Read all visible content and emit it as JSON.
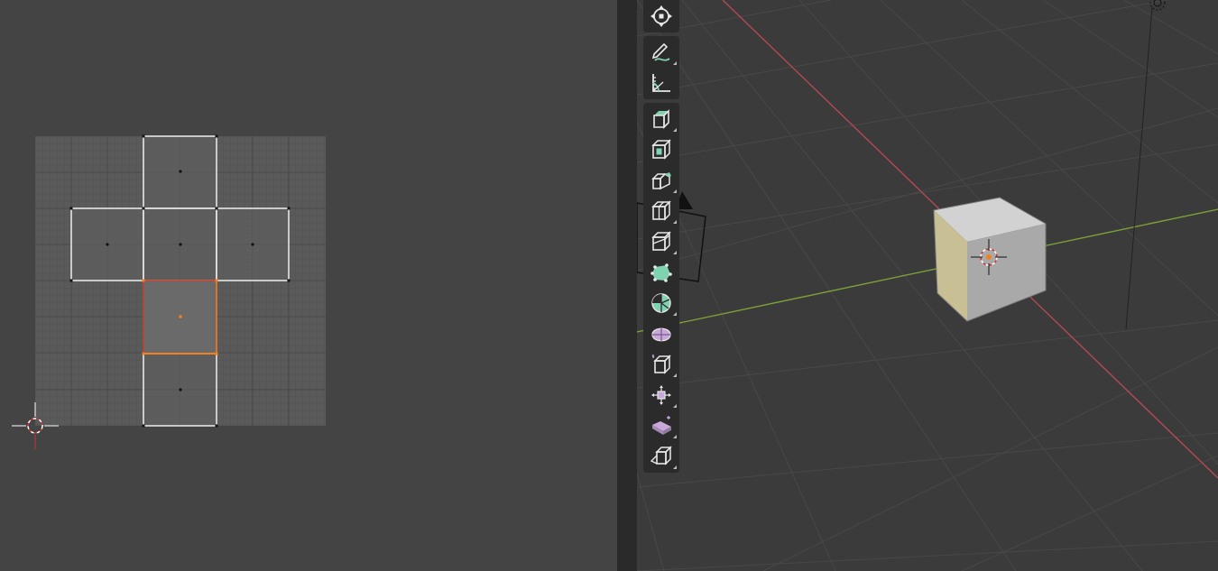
{
  "colors": {
    "uv_background": "#444444",
    "uv_grid_fill": "#5b5b5b",
    "selection_orange": "#f08020",
    "selection_red": "#c8402a",
    "x_axis": "#b34956",
    "y_axis": "#7da038",
    "tool_mint": "#7fd3b0",
    "tool_lavender": "#c8a8d8"
  },
  "uv_editor": {
    "grid": "uv-grid",
    "cursor_icon": "2d-cursor-icon",
    "uv_faces": [
      "top",
      "left",
      "center",
      "right",
      "selected",
      "bottom"
    ]
  },
  "toolbar": {
    "tools": [
      {
        "name": "transform",
        "icon": "transform-gizmo-icon"
      },
      {
        "name": "annotate",
        "icon": "annotate-pencil-icon"
      },
      {
        "name": "measure",
        "icon": "measure-ruler-icon"
      },
      {
        "name": "extrude-region",
        "icon": "extrude-region-icon"
      },
      {
        "name": "inset-faces",
        "icon": "inset-faces-icon"
      },
      {
        "name": "bevel",
        "icon": "bevel-icon"
      },
      {
        "name": "loop-cut",
        "icon": "loop-cut-icon"
      },
      {
        "name": "knife",
        "icon": "knife-icon"
      },
      {
        "name": "poly-build",
        "icon": "poly-build-icon"
      },
      {
        "name": "spin",
        "icon": "spin-icon"
      },
      {
        "name": "smooth",
        "icon": "smooth-vertices-icon"
      },
      {
        "name": "edge-slide",
        "icon": "edge-slide-icon"
      },
      {
        "name": "shrink-fatten",
        "icon": "shrink-fatten-icon"
      },
      {
        "name": "shear",
        "icon": "shear-icon"
      },
      {
        "name": "rip-region",
        "icon": "rip-region-icon"
      }
    ]
  }
}
